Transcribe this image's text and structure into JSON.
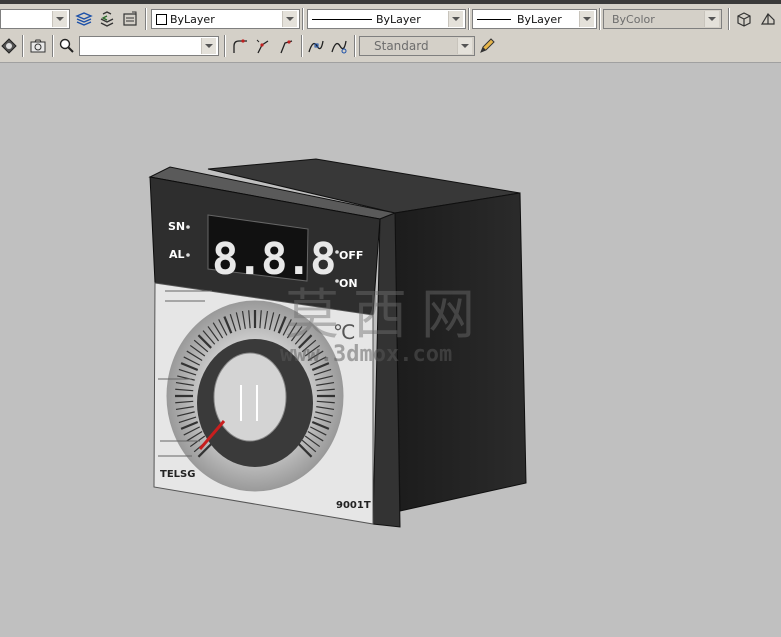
{
  "toolbar_row1": {
    "layer_color": "ByLayer",
    "linetype": "ByLayer",
    "lineweight": "ByLayer",
    "plot_style": "ByColor"
  },
  "toolbar_row2": {
    "view_combo": "",
    "text_style": "Standard"
  },
  "model": {
    "sn_label": "SN",
    "al_label": "AL",
    "display_digits": "8.8.8",
    "off_label": "OFF",
    "on_label": "ON",
    "unit": "℃",
    "brand": "TELSG",
    "model_no": "9001T"
  },
  "watermark": {
    "chinese": "莫西网",
    "url": "www.3dmox.com"
  }
}
